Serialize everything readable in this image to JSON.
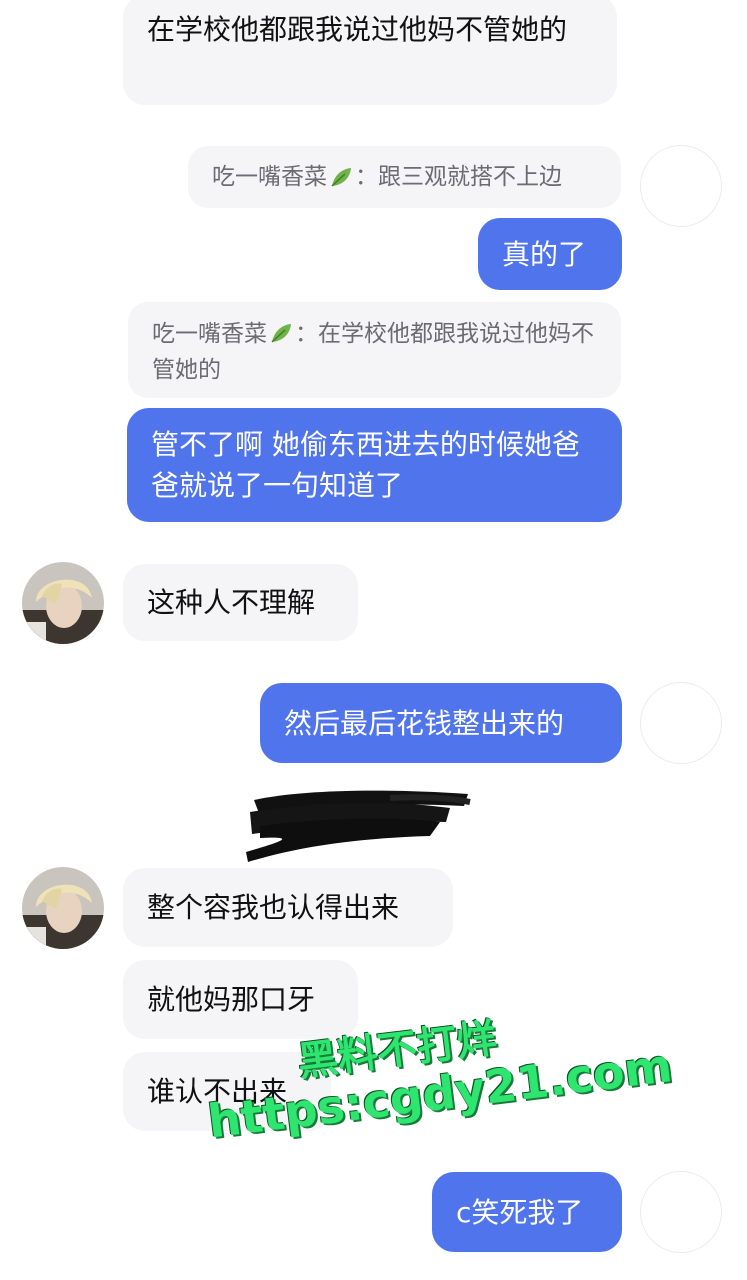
{
  "messages": [
    {
      "side": "in",
      "text": "在学校他都跟我说过他妈不管她的"
    },
    {
      "side": "quote",
      "sender": "吃一嘴香菜",
      "text": "跟三观就搭不上边"
    },
    {
      "side": "out",
      "text": "真的了"
    },
    {
      "side": "quote",
      "sender": "吃一嘴香菜",
      "text": "在学校他都跟我说过他妈不管她的"
    },
    {
      "side": "out",
      "text": "管不了啊 她偷东西进去的时候她爸爸就说了一句知道了"
    },
    {
      "side": "in",
      "text": "这种人不理解"
    },
    {
      "side": "out",
      "text": "然后最后花钱整出来的"
    },
    {
      "side": "in",
      "text": "整个容我也认得出来"
    },
    {
      "side": "in",
      "text": "就他妈那口牙"
    },
    {
      "side": "in",
      "text": "谁认不出来"
    },
    {
      "side": "out",
      "text": "c笑死我了"
    }
  ],
  "quote_separator": "：",
  "leaf_icon": "leaf-emoji",
  "watermark": {
    "line1": "黑料不打烊",
    "line2": "https:cgdy21.com"
  },
  "colors": {
    "outgoing_bubble": "#4f74ec",
    "incoming_bubble": "#f5f5f7",
    "watermark": "#2ee56f"
  }
}
